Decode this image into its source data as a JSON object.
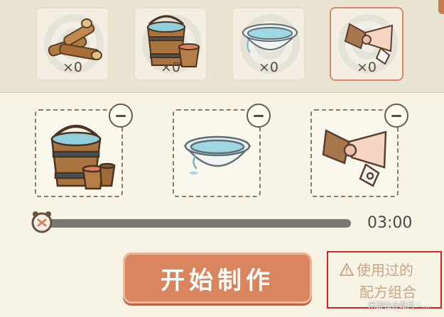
{
  "inventory": [
    {
      "name": "firewood",
      "count": "×0",
      "selected": false
    },
    {
      "name": "water-buckets",
      "count": "×0",
      "selected": false
    },
    {
      "name": "water-basin",
      "count": "×0",
      "selected": false
    },
    {
      "name": "cloth-bundle",
      "count": "×0",
      "selected": true
    }
  ],
  "recipe_slots": [
    {
      "name": "water-buckets"
    },
    {
      "name": "water-basin"
    },
    {
      "name": "cloth-bundle"
    }
  ],
  "timer": {
    "time": "03:00",
    "progress": 0
  },
  "start_button": {
    "label": "开始制作"
  },
  "used_combo": {
    "line1": "使用过的",
    "line2": "配方组合",
    "warning_icon": "warning-icon"
  },
  "watermark": "米游社@维月丶..."
}
